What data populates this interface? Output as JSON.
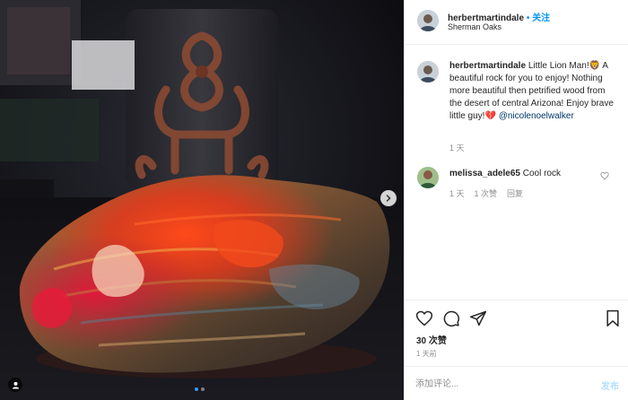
{
  "header": {
    "username": "herbertmartindale",
    "follow_label": "• 关注",
    "location": "Sherman Oaks"
  },
  "caption": {
    "username": "herbertmartindale",
    "text": "Little Lion Man!🦁 A beautiful rock for you to enjoy! Nothing more beautiful then petrified wood from the desert of central Arizona! Enjoy brave little guy!💔",
    "mention": "@nicolenoelwalker",
    "time": "1 天"
  },
  "comments": [
    {
      "username": "melissa_adele65",
      "text": "Cool rock",
      "time": "1 天",
      "likes": "1 次赞",
      "reply_label": "回复"
    }
  ],
  "actions": {
    "like_icon": "heart-outline-icon",
    "comment_icon": "speech-bubble-icon",
    "share_icon": "paper-plane-icon",
    "save_icon": "bookmark-icon"
  },
  "likes_count": "30 次赞",
  "post_time": "1 天前",
  "add_comment": {
    "placeholder": "添加评论...",
    "post_label": "发布"
  },
  "carousel": {
    "total_slides": 2,
    "active_slide": 1
  },
  "colors": {
    "link_blue": "#0095f6",
    "mention_blue": "#00376b",
    "post_button_disabled": "#b2dffc",
    "muted_text": "#8e8e8e",
    "carousel_active_dot": "#3897f0"
  }
}
